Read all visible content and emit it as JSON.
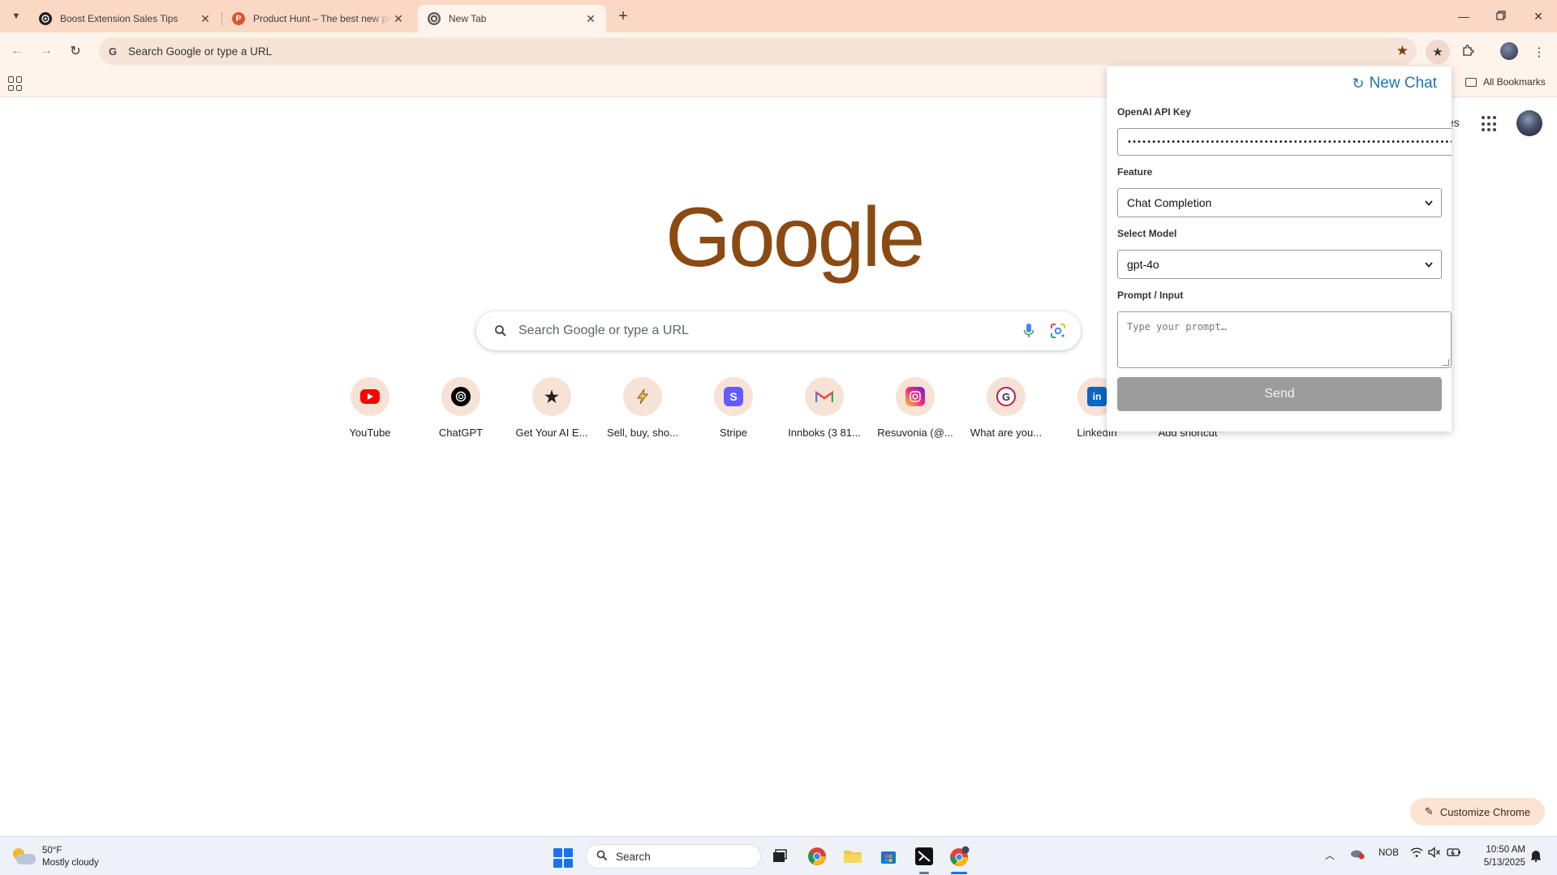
{
  "browser": {
    "tabs": [
      {
        "title": "Boost Extension Sales Tips",
        "active": false
      },
      {
        "title": "Product Hunt – The best new products in tech",
        "active": false
      },
      {
        "title": "New Tab",
        "active": true
      }
    ],
    "address_bar": {
      "placeholder": "Search Google or type a URL"
    },
    "bookmarks_bar": {
      "all_bookmarks_label": "All Bookmarks"
    }
  },
  "ntp": {
    "logo_text": "Google",
    "search_placeholder": "Search Google or type a URL",
    "partial_right_text": "es",
    "shortcuts": [
      {
        "label": "YouTube",
        "icon": "youtube-icon",
        "color": "#ff0000"
      },
      {
        "label": "ChatGPT",
        "icon": "chatgpt-icon",
        "color": "#000000"
      },
      {
        "label": "Get Your AI E...",
        "icon": "star-icon",
        "color": "#1f1f1f"
      },
      {
        "label": "Sell, buy, sho...",
        "icon": "lightning-icon",
        "color": "#c8a24a"
      },
      {
        "label": "Stripe",
        "icon": "stripe-icon",
        "color": "#635bff"
      },
      {
        "label": "Innboks (3 81...",
        "icon": "gmail-icon",
        "color": "#ea4335"
      },
      {
        "label": "Resuvonia (@...",
        "icon": "instagram-icon",
        "color": "#d62976"
      },
      {
        "label": "What are you...",
        "icon": "grammarly-icon",
        "color": "#c2185b"
      },
      {
        "label": "LinkedIn",
        "icon": "linkedin-icon",
        "color": "#0a66c2"
      },
      {
        "label": "Add shortcut",
        "icon": "plus-icon",
        "color": "#1f1f1f"
      }
    ],
    "customize_label": "Customize Chrome"
  },
  "extension_popup": {
    "new_chat_label": "New Chat",
    "api_key_label": "OpenAI API Key",
    "api_key_value": "••••••••••••••••••••••••••••••••••••••••••••••••••••••••••••••••••••••••••••••••••",
    "feature_label": "Feature",
    "feature_value": "Chat Completion",
    "model_label": "Select Model",
    "model_value": "gpt-4o",
    "prompt_label": "Prompt / Input",
    "prompt_placeholder": "Type your prompt…",
    "send_label": "Send"
  },
  "taskbar": {
    "weather_temp": "50°F",
    "weather_desc": "Mostly cloudy",
    "search_label": "Search",
    "language": "NOB",
    "time": "10:50 AM",
    "date": "5/13/2025"
  },
  "colors": {
    "tabstrip": "#fbd8c3",
    "toolbar": "#fff4ec",
    "logo": "#8a4a12",
    "link_blue": "#1f73b7",
    "send_disabled": "#9c9c9c"
  }
}
